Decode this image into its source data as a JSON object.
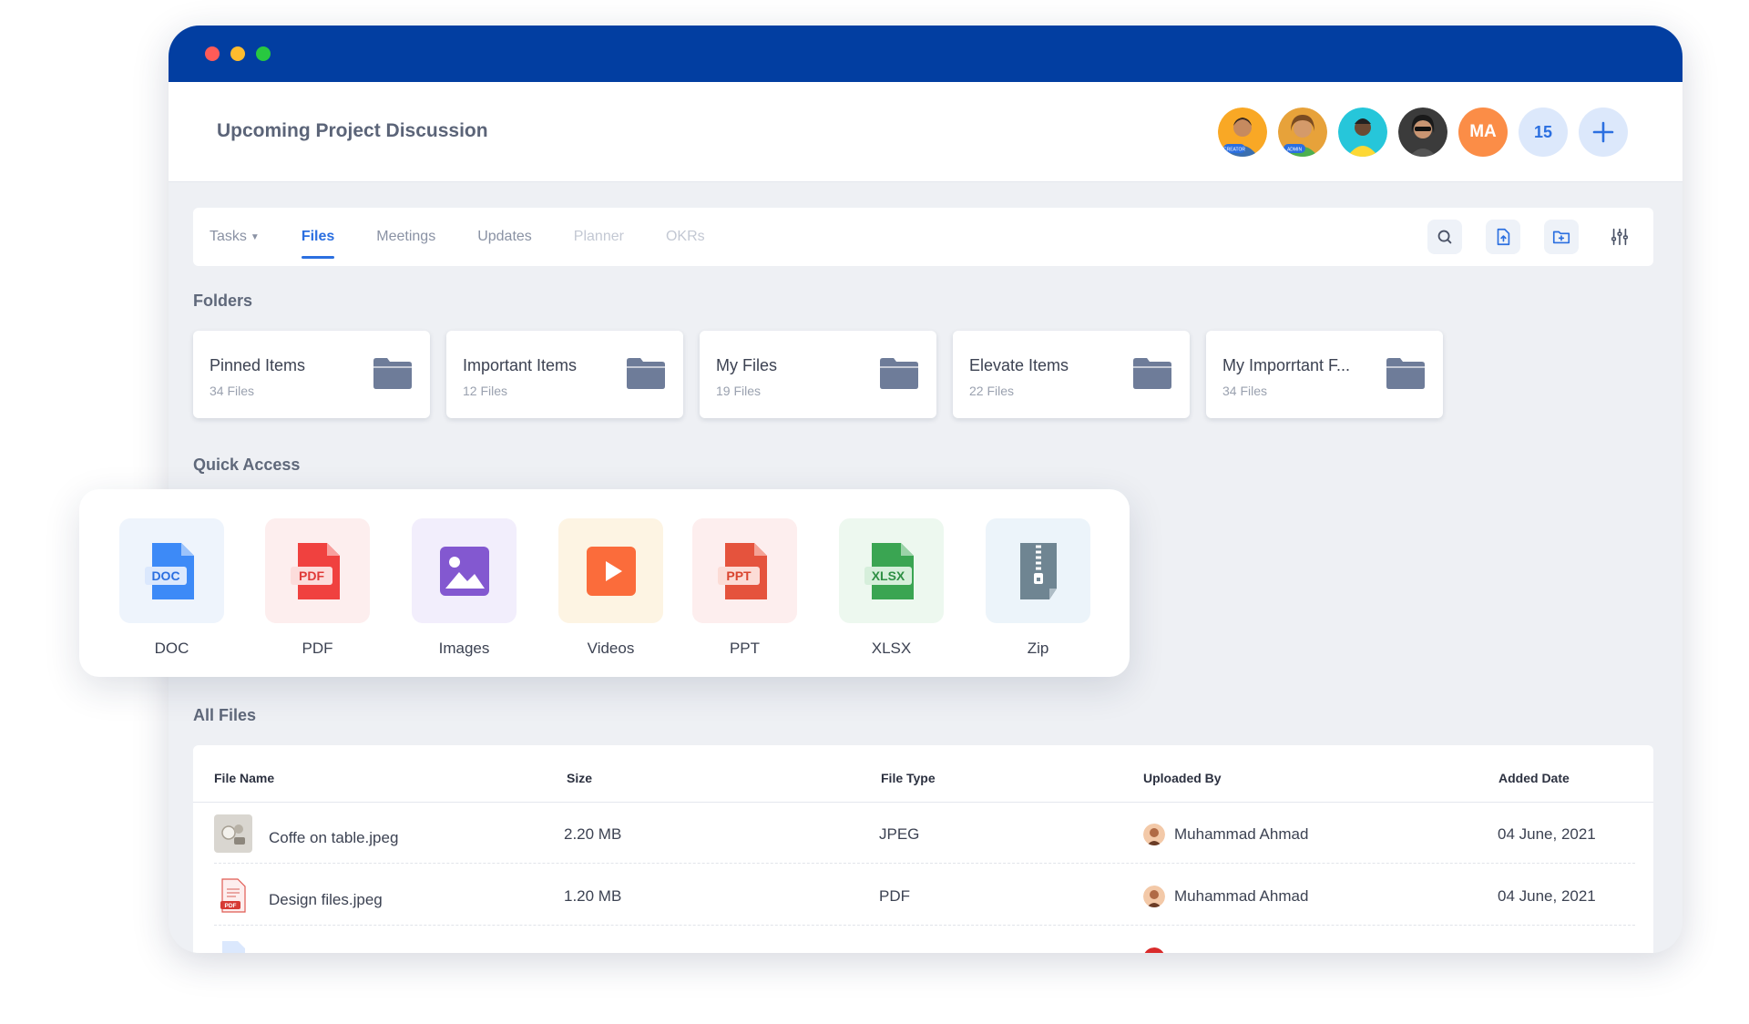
{
  "window": {
    "traffic_lights": [
      "close",
      "minimize",
      "maximize"
    ]
  },
  "header": {
    "title": "Upcoming Project Discussion",
    "members": [
      {
        "badge": "CREATOR",
        "color": "#f9a825"
      },
      {
        "badge": "ADMIN",
        "color": "#e7a23a"
      },
      {
        "badge": "",
        "color": "#26c6da"
      },
      {
        "badge": "",
        "color": "#3b3b3b"
      }
    ],
    "initials_avatar": "MA",
    "member_count": "15",
    "add_member_icon": "plus-icon"
  },
  "tabs": [
    {
      "label": "Tasks",
      "has_caret": true,
      "state": "normal"
    },
    {
      "label": "Files",
      "state": "active"
    },
    {
      "label": "Meetings",
      "state": "normal"
    },
    {
      "label": "Updates",
      "state": "normal"
    },
    {
      "label": "Planner",
      "state": "muted"
    },
    {
      "label": "OKRs",
      "state": "muted"
    }
  ],
  "toolbar_icons": [
    "search-icon",
    "upload-file-icon",
    "new-folder-icon",
    "filter-sliders-icon"
  ],
  "folders": {
    "title": "Folders",
    "items": [
      {
        "name": "Pinned Items",
        "count": "34 Files"
      },
      {
        "name": "Important Items",
        "count": "12 Files"
      },
      {
        "name": "My Files",
        "count": "19 Files"
      },
      {
        "name": "Elevate Items",
        "count": "22 Files"
      },
      {
        "name": "My Imporrtant F...",
        "count": "34 Files"
      }
    ]
  },
  "quick_access": {
    "title": "Quick Access",
    "items": [
      {
        "label": "DOC",
        "badge": "DOC",
        "color": "#3d8af7",
        "bg": "#eef4fc"
      },
      {
        "label": "PDF",
        "badge": "PDF",
        "color": "#f0413f",
        "bg": "#fdeeee"
      },
      {
        "label": "Images",
        "badge": "",
        "color": "#8358d0",
        "bg": "#f2eefc"
      },
      {
        "label": "Videos",
        "badge": "",
        "color": "#fb6c3b",
        "bg": "#fdf4e3"
      },
      {
        "label": "PPT",
        "badge": "PPT",
        "color": "#e5533d",
        "bg": "#fdeeee"
      },
      {
        "label": "XLSX",
        "badge": "XLSX",
        "color": "#3aa552",
        "bg": "#edf8ef"
      },
      {
        "label": "Zip",
        "badge": "",
        "color": "#6f8592",
        "bg": "#ecf4fa"
      }
    ]
  },
  "all_files": {
    "title": "All Files",
    "columns": [
      "File Name",
      "Size",
      "File Type",
      "Uploaded By",
      "Added Date"
    ],
    "rows": [
      {
        "name": "Coffe on table.jpeg",
        "size": "2.20 MB",
        "type": "JPEG",
        "uploader": "Muhammad Ahmad",
        "date": "04 June, 2021",
        "thumb": "image"
      },
      {
        "name": "Design files.jpeg",
        "size": "1.20 MB",
        "type": "PDF",
        "uploader": "Muhammad Ahmad",
        "date": "04 June, 2021",
        "thumb": "pdf"
      }
    ]
  },
  "colors": {
    "titlebar": "#023ea1",
    "accent": "#2b6fe0",
    "folder": "#6e7c99"
  }
}
